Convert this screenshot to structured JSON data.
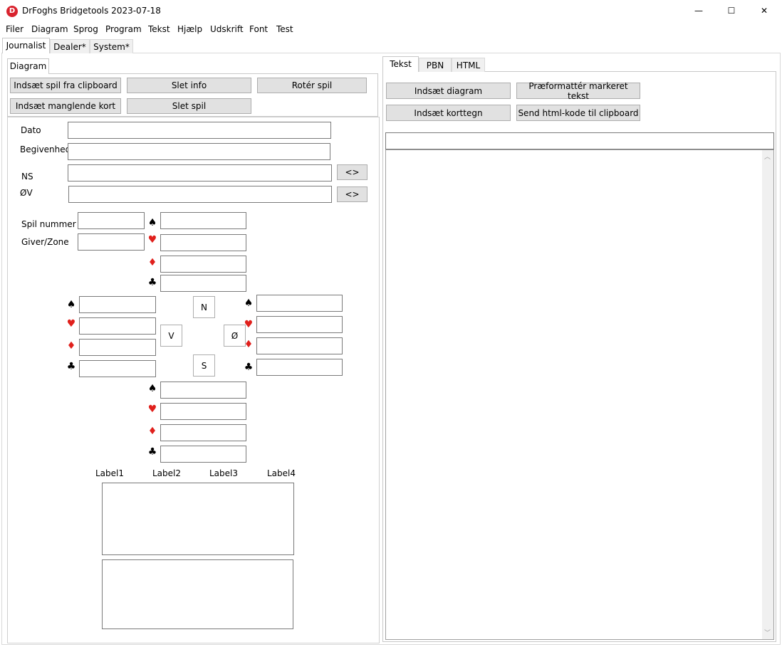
{
  "window": {
    "title": "DrFoghs Bridgetools 2023-07-18",
    "icon": "D"
  },
  "controls": {
    "minimize": "—",
    "maximize": "☐",
    "close": "✕"
  },
  "menu": [
    "Filer",
    "Diagram",
    "Sprog",
    "Program",
    "Tekst",
    "Hjælp",
    "Udskrift",
    "Font",
    "Test"
  ],
  "main_tabs": [
    "Journalist",
    "Dealer*",
    "System*"
  ],
  "left": {
    "subtab": "Diagram",
    "buttons": {
      "paste_clipboard": "Indsæt spil fra clipboard",
      "delete_info": "Slet info",
      "rotate": "Rotér spil",
      "insert_missing": "Indsæt manglende kort",
      "delete_game": "Slet spil"
    },
    "labels": {
      "dato": "Dato",
      "begivenhed": "Begivenhed",
      "ns": "NS",
      "ov": "ØV",
      "spil_nummer": "Spil nummer",
      "giver_zone": "Giver/Zone"
    },
    "swap": "<>",
    "compass": {
      "n": "N",
      "v": "V",
      "o": "Ø",
      "s": "S"
    },
    "suits": {
      "spade": "♠",
      "heart": "♥",
      "diamond": "♦",
      "club": "♣"
    },
    "bottom_labels": [
      "Label1",
      "Label2",
      "Label3",
      "Label4"
    ]
  },
  "right": {
    "tabs": [
      "Tekst",
      "PBN",
      "HTML"
    ],
    "buttons": {
      "insert_diagram": "Indsæt diagram",
      "preformat": "Præformattér markeret tekst",
      "insert_suit": "Indsæt korttegn",
      "send_html": "Send html-kode til clipboard"
    }
  }
}
